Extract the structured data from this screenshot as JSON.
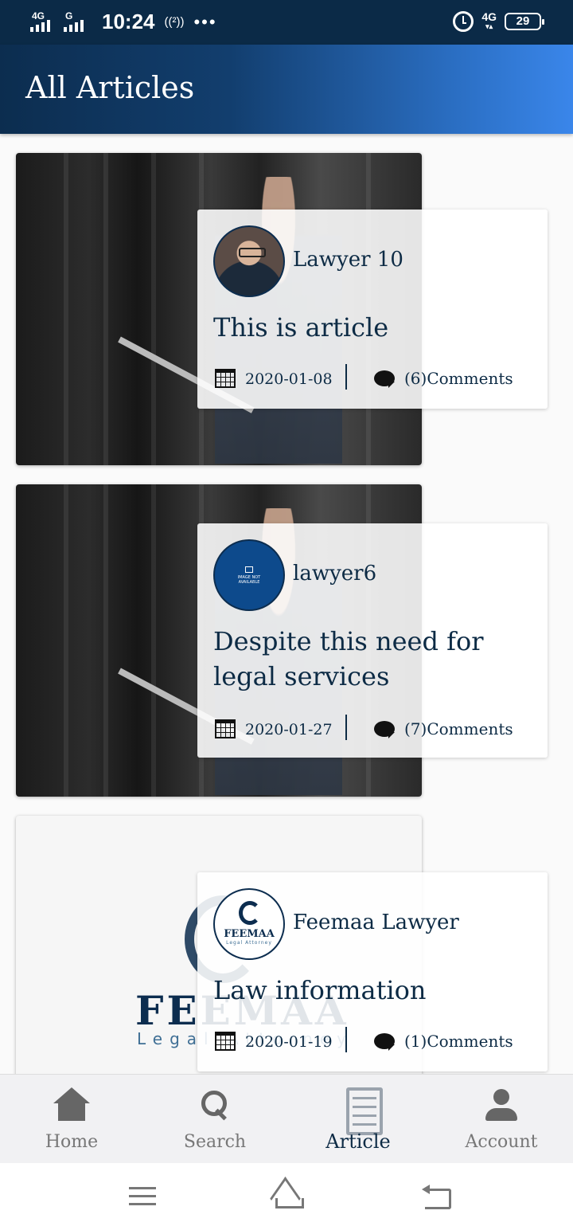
{
  "status_bar": {
    "network1": "4G",
    "network2": "G",
    "time": "10:24",
    "hotspot": "((²))",
    "more": "•••",
    "network3": "4G",
    "battery": "29"
  },
  "app_bar": {
    "title": "All Articles"
  },
  "articles": [
    {
      "author": "Lawyer 10",
      "title": "This is article",
      "date": "2020-01-08",
      "comments": "(6)Comments",
      "thumbnail": "server-room-photo",
      "avatar": "portrait-photo"
    },
    {
      "author": "lawyer6",
      "title": "Despite this need for legal services",
      "date": "2020-01-27",
      "comments": "(7)Comments",
      "thumbnail": "server-room-photo",
      "avatar": "image-not-available"
    },
    {
      "author": "Feemaa Lawyer",
      "title": "Law information",
      "date": "2020-01-19",
      "comments": "(1)Comments",
      "thumbnail": "feemaa-logo",
      "avatar": "feemaa-logo"
    }
  ],
  "logo": {
    "name": "FEEMAA",
    "tagline": "Legal Attorney",
    "avatar_name": "FEEMAA",
    "avatar_tagline": "Legal Attorney"
  },
  "avatar_placeholder": {
    "line1": "IMAGE NOT",
    "line2": "AVAILABLE"
  },
  "bottom_nav": [
    {
      "label": "Home",
      "icon": "home-icon",
      "active": false
    },
    {
      "label": "Search",
      "icon": "search-icon",
      "active": false
    },
    {
      "label": "Article",
      "icon": "article-icon",
      "active": true
    },
    {
      "label": "Account",
      "icon": "account-icon",
      "active": false
    }
  ],
  "colors": {
    "primary": "#0c2d4f",
    "accent": "#3a86ea",
    "text": "#0d2b45"
  }
}
